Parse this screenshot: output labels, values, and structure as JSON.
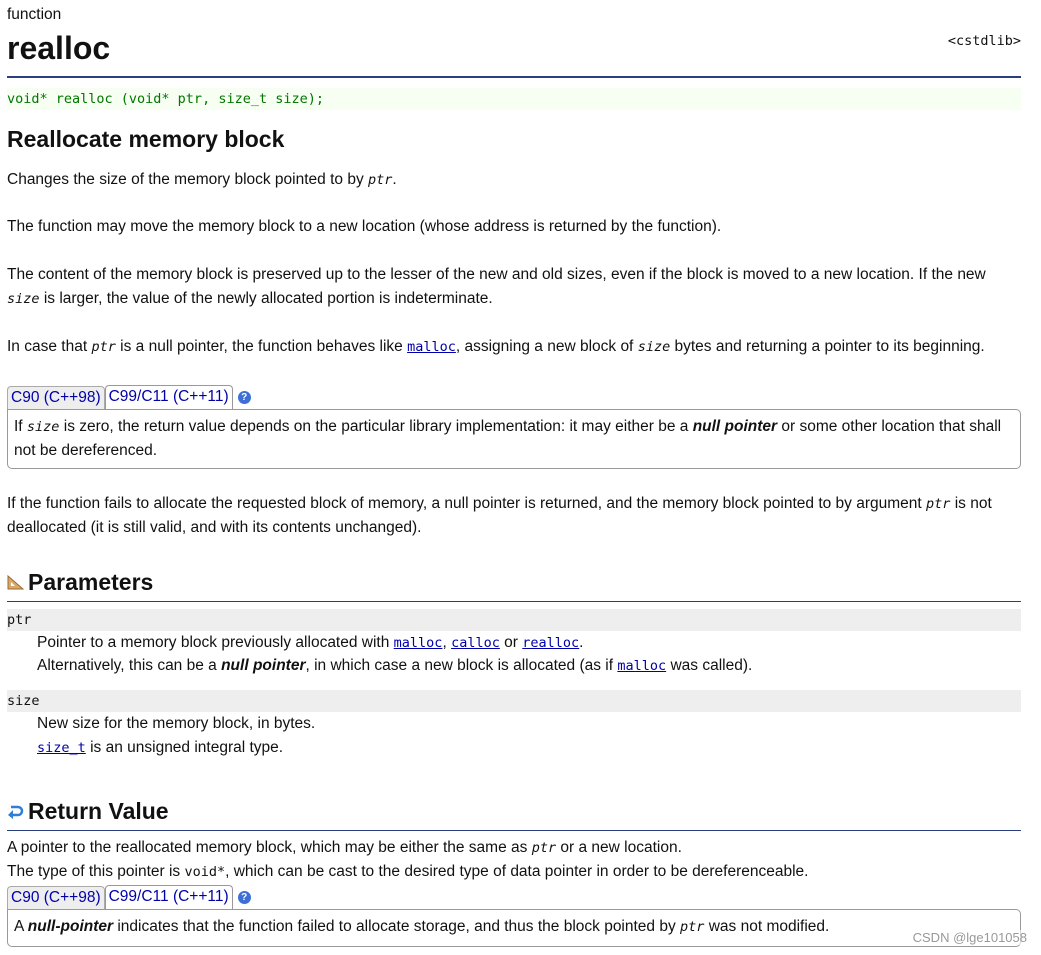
{
  "header": {
    "kind": "function",
    "title": "realloc",
    "header_file": "<cstdlib>",
    "prototype": "void* realloc (void* ptr, size_t size);"
  },
  "summary": {
    "heading": "Reallocate memory block",
    "p1": [
      "Changes the size of the memory block pointed to by ",
      "ptr",
      "."
    ],
    "p2": "The function may move the memory block to a new location (whose address is returned by the function).",
    "p3": [
      "The content of the memory block is preserved up to the lesser of the new and old sizes, even if the block is moved to a new location. If the new ",
      "size",
      " is larger, the value of the newly allocated portion is indeterminate."
    ],
    "p4": [
      "In case that ",
      "ptr",
      " is a null pointer, the function behaves like ",
      "malloc",
      ", assigning a new block of ",
      "size",
      " bytes and returning a pointer to its beginning."
    ],
    "tabs": [
      "C90 (C++98)",
      "C99/C11 (C++11)"
    ],
    "help": "?",
    "box": [
      "If ",
      "size",
      " is zero, the return value depends on the particular library implementation: it may either be a ",
      "null pointer",
      " or some other location that shall not be dereferenced."
    ],
    "p5": [
      "If the function fails to allocate the requested block of memory, a null pointer is returned, and the memory block pointed to by argument ",
      "ptr",
      " is not deallocated (it is still valid, and with its contents unchanged)."
    ]
  },
  "parameters": {
    "heading": "Parameters",
    "icon": "ruler-triangle-icon",
    "ptr": {
      "name": "ptr",
      "l1": [
        "Pointer to a memory block previously allocated with ",
        "malloc",
        ", ",
        "calloc",
        " or ",
        "realloc",
        "."
      ],
      "l2": [
        "Alternatively, this can be a ",
        "null pointer",
        ", in which case a new block is allocated (as if ",
        "malloc",
        " was called)."
      ]
    },
    "size": {
      "name": "size",
      "l1": "New size for the memory block, in bytes.",
      "l2": [
        "size_t",
        " is an unsigned integral type."
      ]
    }
  },
  "return": {
    "heading": "Return Value",
    "icon": "return-arrow-icon",
    "l1": [
      "A pointer to the reallocated memory block, which may be either the same as ",
      "ptr",
      " or a new location."
    ],
    "l2": [
      "The type of this pointer is ",
      "void*",
      ", which can be cast to the desired type of data pointer in order to be dereferenceable."
    ],
    "tabs": [
      "C90 (C++98)",
      "C99/C11 (C++11)"
    ],
    "help": "?",
    "box": [
      "A ",
      "null-pointer",
      " indicates that the function failed to allocate storage, and thus the block pointed by ",
      "ptr",
      " was not modified."
    ]
  },
  "watermark": "CSDN @lge101058"
}
